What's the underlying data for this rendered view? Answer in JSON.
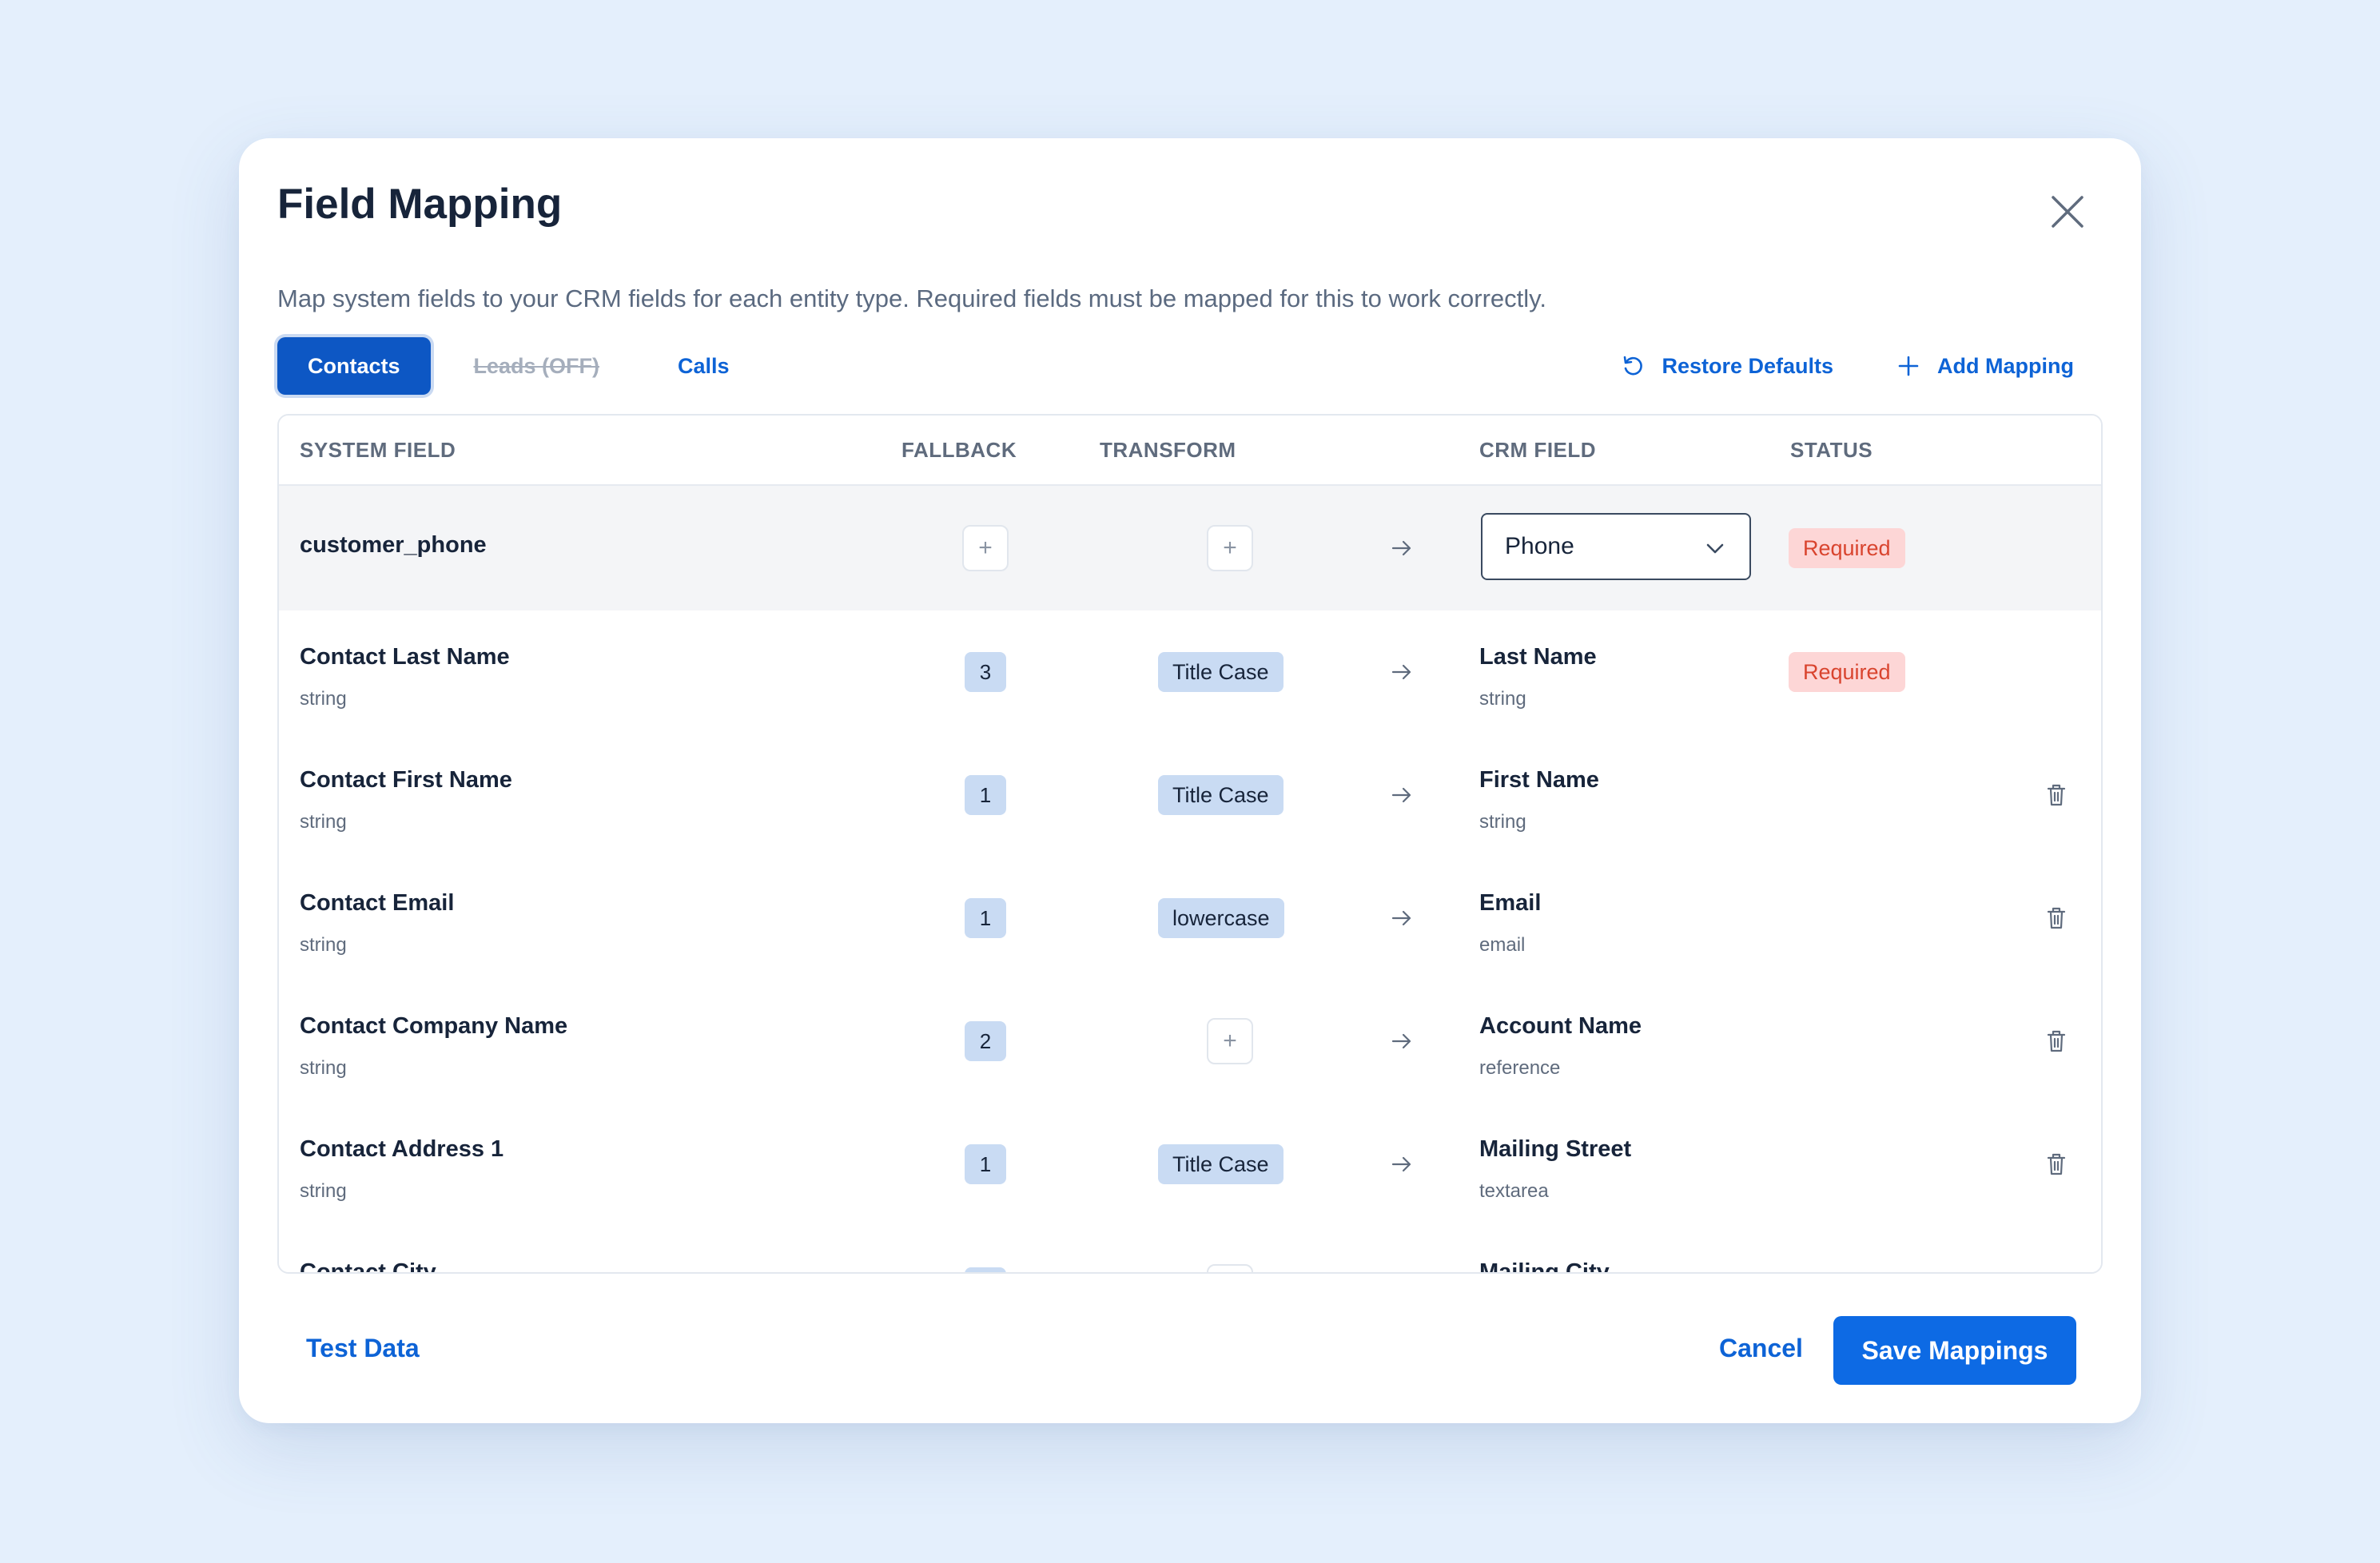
{
  "dialog": {
    "title": "Field Mapping",
    "description": "Map system fields to your CRM fields for each entity type. Required fields must be mapped for this to work correctly."
  },
  "tabs": [
    {
      "label": "Contacts",
      "active": true
    },
    {
      "label": "Leads (OFF)",
      "disabled": true
    },
    {
      "label": "Calls"
    }
  ],
  "actions": {
    "restore_label": "Restore Defaults",
    "add_label": "Add Mapping"
  },
  "table": {
    "headers": {
      "system_field": "SYSTEM FIELD",
      "fallback": "FALLBACK",
      "transform": "TRANSFORM",
      "crm_field": "CRM FIELD",
      "status": "STATUS"
    },
    "rows": [
      {
        "system_field": "customer_phone",
        "system_type": "",
        "fallback": "",
        "transform": "",
        "crm_field": "Phone",
        "crm_type": "",
        "status": "Required"
      },
      {
        "system_field": "Contact Last Name",
        "system_type": "string",
        "fallback": "3",
        "transform": "Title Case",
        "crm_field": "Last Name",
        "crm_type": "string",
        "status": "Required"
      },
      {
        "system_field": "Contact First Name",
        "system_type": "string",
        "fallback": "1",
        "transform": "Title Case",
        "crm_field": "First Name",
        "crm_type": "string",
        "status": ""
      },
      {
        "system_field": "Contact Email",
        "system_type": "string",
        "fallback": "1",
        "transform": "lowercase",
        "crm_field": "Email",
        "crm_type": "email",
        "status": ""
      },
      {
        "system_field": "Contact Company Name",
        "system_type": "string",
        "fallback": "2",
        "transform": "",
        "crm_field": "Account Name",
        "crm_type": "reference",
        "status": ""
      },
      {
        "system_field": "Contact Address 1",
        "system_type": "string",
        "fallback": "1",
        "transform": "Title Case",
        "crm_field": "Mailing Street",
        "crm_type": "textarea",
        "status": ""
      },
      {
        "system_field": "Contact City",
        "system_type": "",
        "fallback": "",
        "transform": "",
        "crm_field": "Mailing City",
        "crm_type": "",
        "status": ""
      }
    ]
  },
  "footer": {
    "test_label": "Test Data",
    "cancel_label": "Cancel",
    "save_label": "Save Mappings"
  },
  "colors": {
    "accent": "#0d63d6",
    "primary_button": "#0d6ae4",
    "active_tab": "#0d57c4",
    "required_bg": "#fdd6d6",
    "required_text": "#d9442e",
    "chip_bg": "#c9dbf3",
    "background": "#e4effc"
  },
  "icons": {
    "close": "close-icon",
    "restore": "restore-icon",
    "add": "plus-icon",
    "arrow": "arrow-right-icon",
    "dropdown": "chevron-down-icon",
    "delete": "trash-icon"
  }
}
